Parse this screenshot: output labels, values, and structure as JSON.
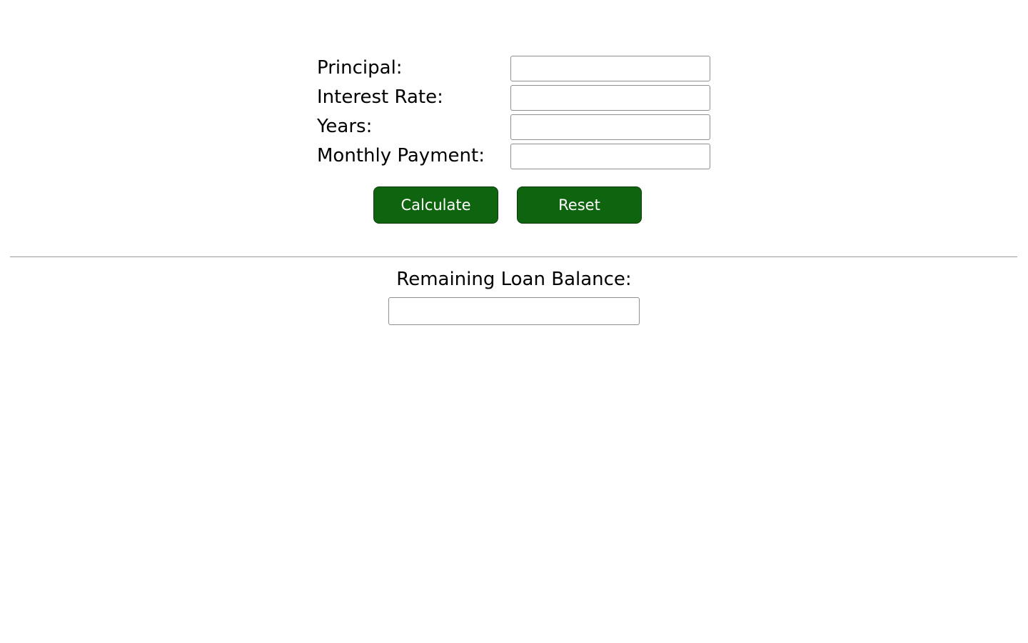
{
  "form": {
    "principal": {
      "label": "Principal:",
      "value": "",
      "placeholder": ""
    },
    "interest_rate": {
      "label": "Interest Rate:",
      "value": "",
      "placeholder": ""
    },
    "years": {
      "label": "Years:",
      "value": "",
      "placeholder": ""
    },
    "monthly_payment": {
      "label": "Monthly Payment:",
      "value": "",
      "placeholder": ""
    }
  },
  "buttons": {
    "calculate_label": "Calculate",
    "reset_label": "Reset"
  },
  "result": {
    "label": "Remaining Loan Balance:",
    "value": "",
    "placeholder": ""
  },
  "colors": {
    "button_background": "#0f650f",
    "button_text": "#ffffff"
  }
}
